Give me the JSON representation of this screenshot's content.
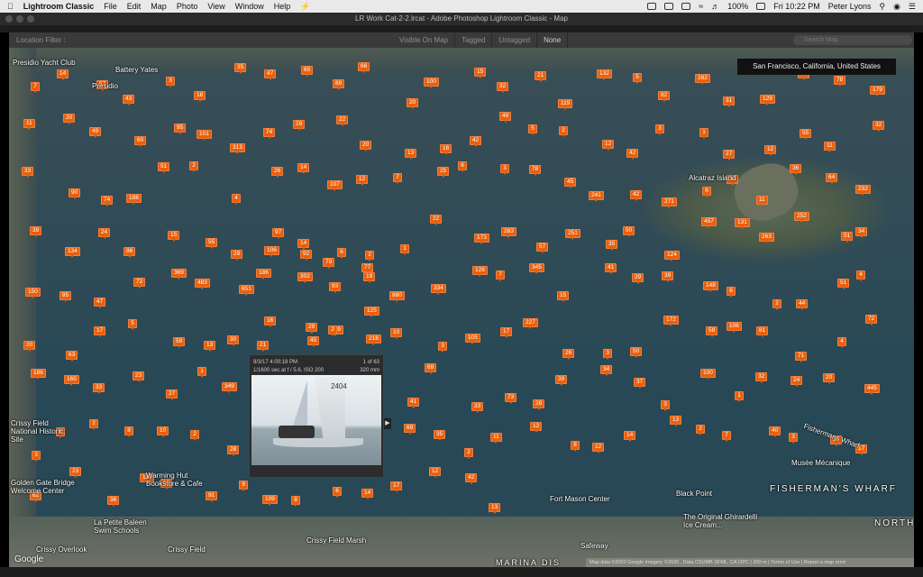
{
  "menubar": {
    "app": "Lightroom Classic",
    "items": [
      "File",
      "Edit",
      "Map",
      "Photo",
      "View",
      "Window",
      "Help"
    ],
    "battery": "100%",
    "clock": "Fri 10:22 PM",
    "user": "Peter Lyons"
  },
  "window": {
    "title": "LR Work Cat-2-2.lrcat - Adobe Photoshop Lightroom Classic - Map"
  },
  "filter": {
    "label": "Location Filter :",
    "options": [
      "Visible On Map",
      "Tagged",
      "Untagged",
      "None"
    ],
    "selected": "None",
    "search_placeholder": "Search Map"
  },
  "location_label": "San Francisco, California, United States",
  "popup": {
    "datetime": "9/3/17 4:00:18 PM",
    "exposure": "1/1600 sec at f / 5.6, ISO 200",
    "focal": "320 mm",
    "count": "1 of 63",
    "sail_number": "2404"
  },
  "places": [
    "Presidio Yacht Club",
    "Battery Yates",
    "Presidio",
    "Alcatraz Island",
    "Crissy Field National Historic Site",
    "Golden Gate Bridge Welcome Center",
    "Warming Hut Bookstore & Cafe",
    "La Petite Baleen Swim Schools",
    "Crissy Field",
    "Fort Mason Center",
    "Black Point",
    "Safeway",
    "Musée Mécanique",
    "FISHERMAN'S WHARF",
    "Fishermans Wharf",
    "The Original Ghirardelli Ice Cream...",
    "Crissy Field Marsh",
    "Crissy Overlook",
    "MARINA DIS",
    "NORTH"
  ],
  "attribution": "Map data ©2020 Google Imagery ©2020 , Data CSUMB SFML, CA OPC | 200 m | Terms of Use | Report a map error",
  "google": "Google",
  "pins": [
    "7",
    "14",
    "57",
    "43",
    "3",
    "18",
    "35",
    "47",
    "65",
    "89",
    "66",
    "20",
    "100",
    "15",
    "32",
    "21",
    "119",
    "132",
    "5",
    "82",
    "282",
    "31",
    "129",
    "48",
    "78",
    "179",
    "11",
    "20",
    "49",
    "60",
    "95",
    "101",
    "313",
    "74",
    "29",
    "22",
    "20",
    "13",
    "16",
    "42",
    "49",
    "5",
    "2",
    "12",
    "42",
    "3",
    "1",
    "27",
    "12",
    "55",
    "11",
    "32",
    "33",
    "90",
    "74",
    "188",
    "51",
    "2",
    "4",
    "26",
    "14",
    "107",
    "12",
    "7",
    "25",
    "6",
    "3",
    "78",
    "45",
    "241",
    "42",
    "271",
    "6",
    "34",
    "11",
    "36",
    "64",
    "232",
    "39",
    "134",
    "24",
    "86",
    "15",
    "55",
    "29",
    "97",
    "14",
    "6",
    "2",
    "1",
    "22",
    "173",
    "283",
    "57",
    "251",
    "35",
    "50",
    "124",
    "457",
    "131",
    "263",
    "252",
    "51",
    "34",
    "150",
    "85",
    "47",
    "72",
    "369",
    "483",
    "651",
    "186",
    "302",
    "93",
    "77",
    "880",
    "334",
    "128",
    "7",
    "345",
    "15",
    "41",
    "29",
    "39",
    "148",
    "6",
    "2",
    "44",
    "51",
    "4",
    "20",
    "63",
    "17",
    "5",
    "59",
    "13",
    "30",
    "21",
    "45",
    "139",
    "218",
    "10",
    "3",
    "105",
    "17",
    "227",
    "26",
    "3",
    "50",
    "172",
    "58",
    "106",
    "81",
    "71",
    "4",
    "72",
    "186",
    "165",
    "33",
    "23",
    "27",
    "1",
    "349",
    "106",
    "92",
    "79",
    "19",
    "41",
    "68",
    "33",
    "73",
    "28",
    "39",
    "34",
    "37",
    "3",
    "100",
    "1",
    "32",
    "24",
    "20",
    "445",
    "3",
    "6",
    "2",
    "8",
    "10",
    "2",
    "28",
    "16",
    "28",
    "2",
    "125",
    "69",
    "35",
    "2",
    "11",
    "12",
    "8",
    "12",
    "14",
    "13",
    "2",
    "7",
    "40",
    "3",
    "24",
    "17",
    "62",
    "23",
    "36",
    "110",
    "10",
    "91",
    "9",
    "109",
    "8",
    "6",
    "14",
    "17",
    "12",
    "42",
    "13"
  ]
}
